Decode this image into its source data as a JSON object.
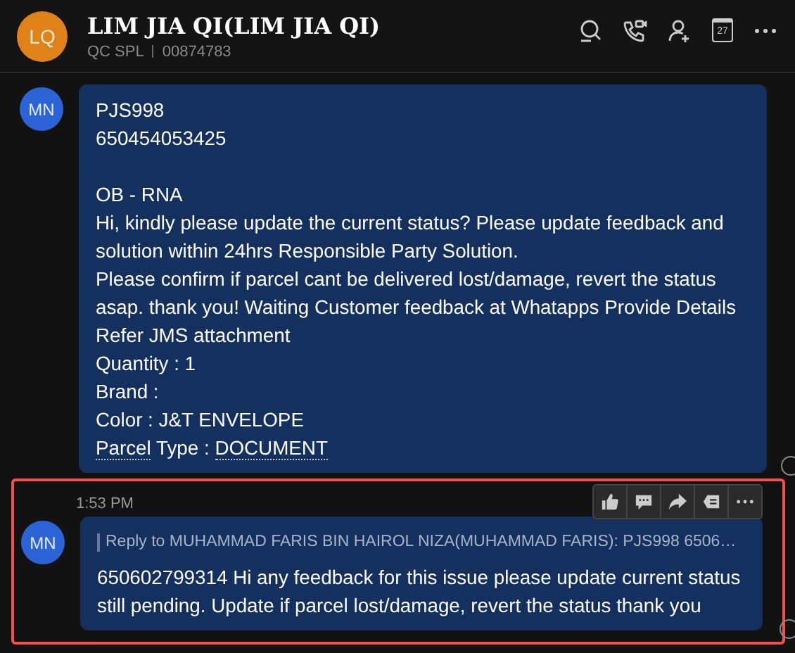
{
  "header": {
    "avatar_initials": "LQ",
    "title": "LIM JIA QI(LIM JIA QI)",
    "subtitle_parts": [
      "QC SPL",
      "00874783"
    ],
    "calendar_day": "27"
  },
  "messages": [
    {
      "avatar_initials": "MN",
      "highlighted": false,
      "blocks": [
        [
          "PJS998",
          "650454053425"
        ],
        [
          "OB - RNA",
          "Hi, kindly please update the current status? Please update feedback and solution within 24hrs Responsible Party Solution.",
          "Please confirm if parcel cant be delivered lost/damage, revert the status asap. thank you! Waiting Customer feedback at Whatapps Provide Details Refer JMS attachment",
          "Quantity : 1",
          "Brand :",
          "Color : J&T ENVELOPE"
        ]
      ],
      "segmented_line": [
        {
          "text": "Parcel",
          "underlined": true
        },
        {
          "text": " Type : ",
          "underlined": false
        },
        {
          "text": "DOCUMENT",
          "underlined": true
        }
      ]
    },
    {
      "avatar_initials": "MN",
      "highlighted": true,
      "time": "1:53 PM",
      "reply_quote": "Reply to MUHAMMAD FARIS BIN HAIROL NIZA(MUHAMMAD FARIS):  PJS998 6506…",
      "blocks": [
        [
          "650602799314 Hi any feedback for this issue please update current status still pending. Update if parcel lost/damage, revert the status thank you"
        ]
      ]
    }
  ]
}
